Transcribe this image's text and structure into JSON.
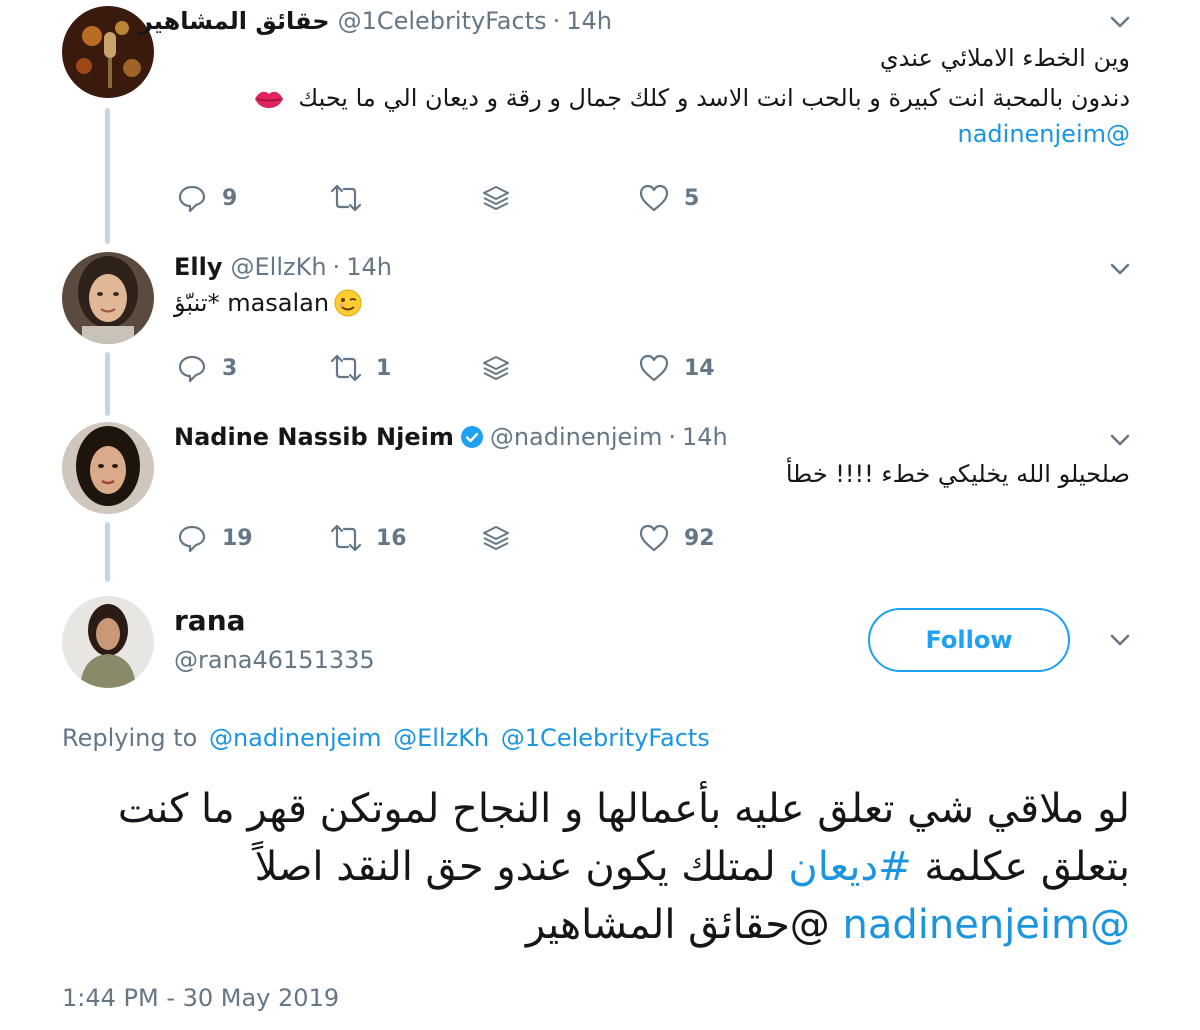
{
  "replies": [
    {
      "name": "حقائق المشاهير",
      "handle": "@1CelebrityFacts",
      "time": "14h",
      "lines": [
        "وين الخطء الاملائي عندي",
        "دندون بالمحبة انت كبيرة و بالحب انت الاسد و كلك جمال و رقة و ديعان الي ما يحبك"
      ],
      "mention": "@nadinenjeim",
      "emoji": "kiss-lips-icon",
      "reply_count": "9",
      "retweet_count": "",
      "like_count": "5"
    },
    {
      "name": "Elly",
      "handle": "@EllzKh",
      "time": "14h",
      "text": "تنبّؤ* masalan",
      "emoji": "winking-face-icon",
      "reply_count": "3",
      "retweet_count": "1",
      "like_count": "14"
    },
    {
      "name": "Nadine Nassib Njeim",
      "handle": "@nadinenjeim",
      "time": "14h",
      "verified": true,
      "text": "صلحيلو الله يخليكي خطء !!!! خطأ",
      "reply_count": "19",
      "retweet_count": "16",
      "like_count": "92"
    }
  ],
  "main_tweet": {
    "name": "rana",
    "handle": "@rana46151335",
    "follow_label": "Follow",
    "replying_label": "Replying to",
    "replying_to": [
      "@nadinenjeim",
      "@EllzKh",
      "@1CelebrityFacts"
    ],
    "line1": "لو ملاقي شي تعلق عليه بأعمالها و النجاح لموتكن قهر ما كنت",
    "line2_start": "بتعلق عكلمة ",
    "hashtag": "#ديعان",
    "line2_end": " لمتلك يكون عندو حق النقد اصلاً",
    "line3_at": "@حقائق المشاهير",
    "mention": "@nadinenjeim",
    "timestamp": "1:44 PM - 30 May 2019"
  },
  "colors": {
    "link": "#1b95e0",
    "secondary_text": "#657786",
    "primary_text": "#14171a",
    "thread_line": "#c4d6e4",
    "follow_border": "#1da1f2"
  },
  "icons": [
    "reply-icon",
    "retweet-icon",
    "stack-icon",
    "heart-icon",
    "chevron-down-icon",
    "verified-badge-icon"
  ]
}
